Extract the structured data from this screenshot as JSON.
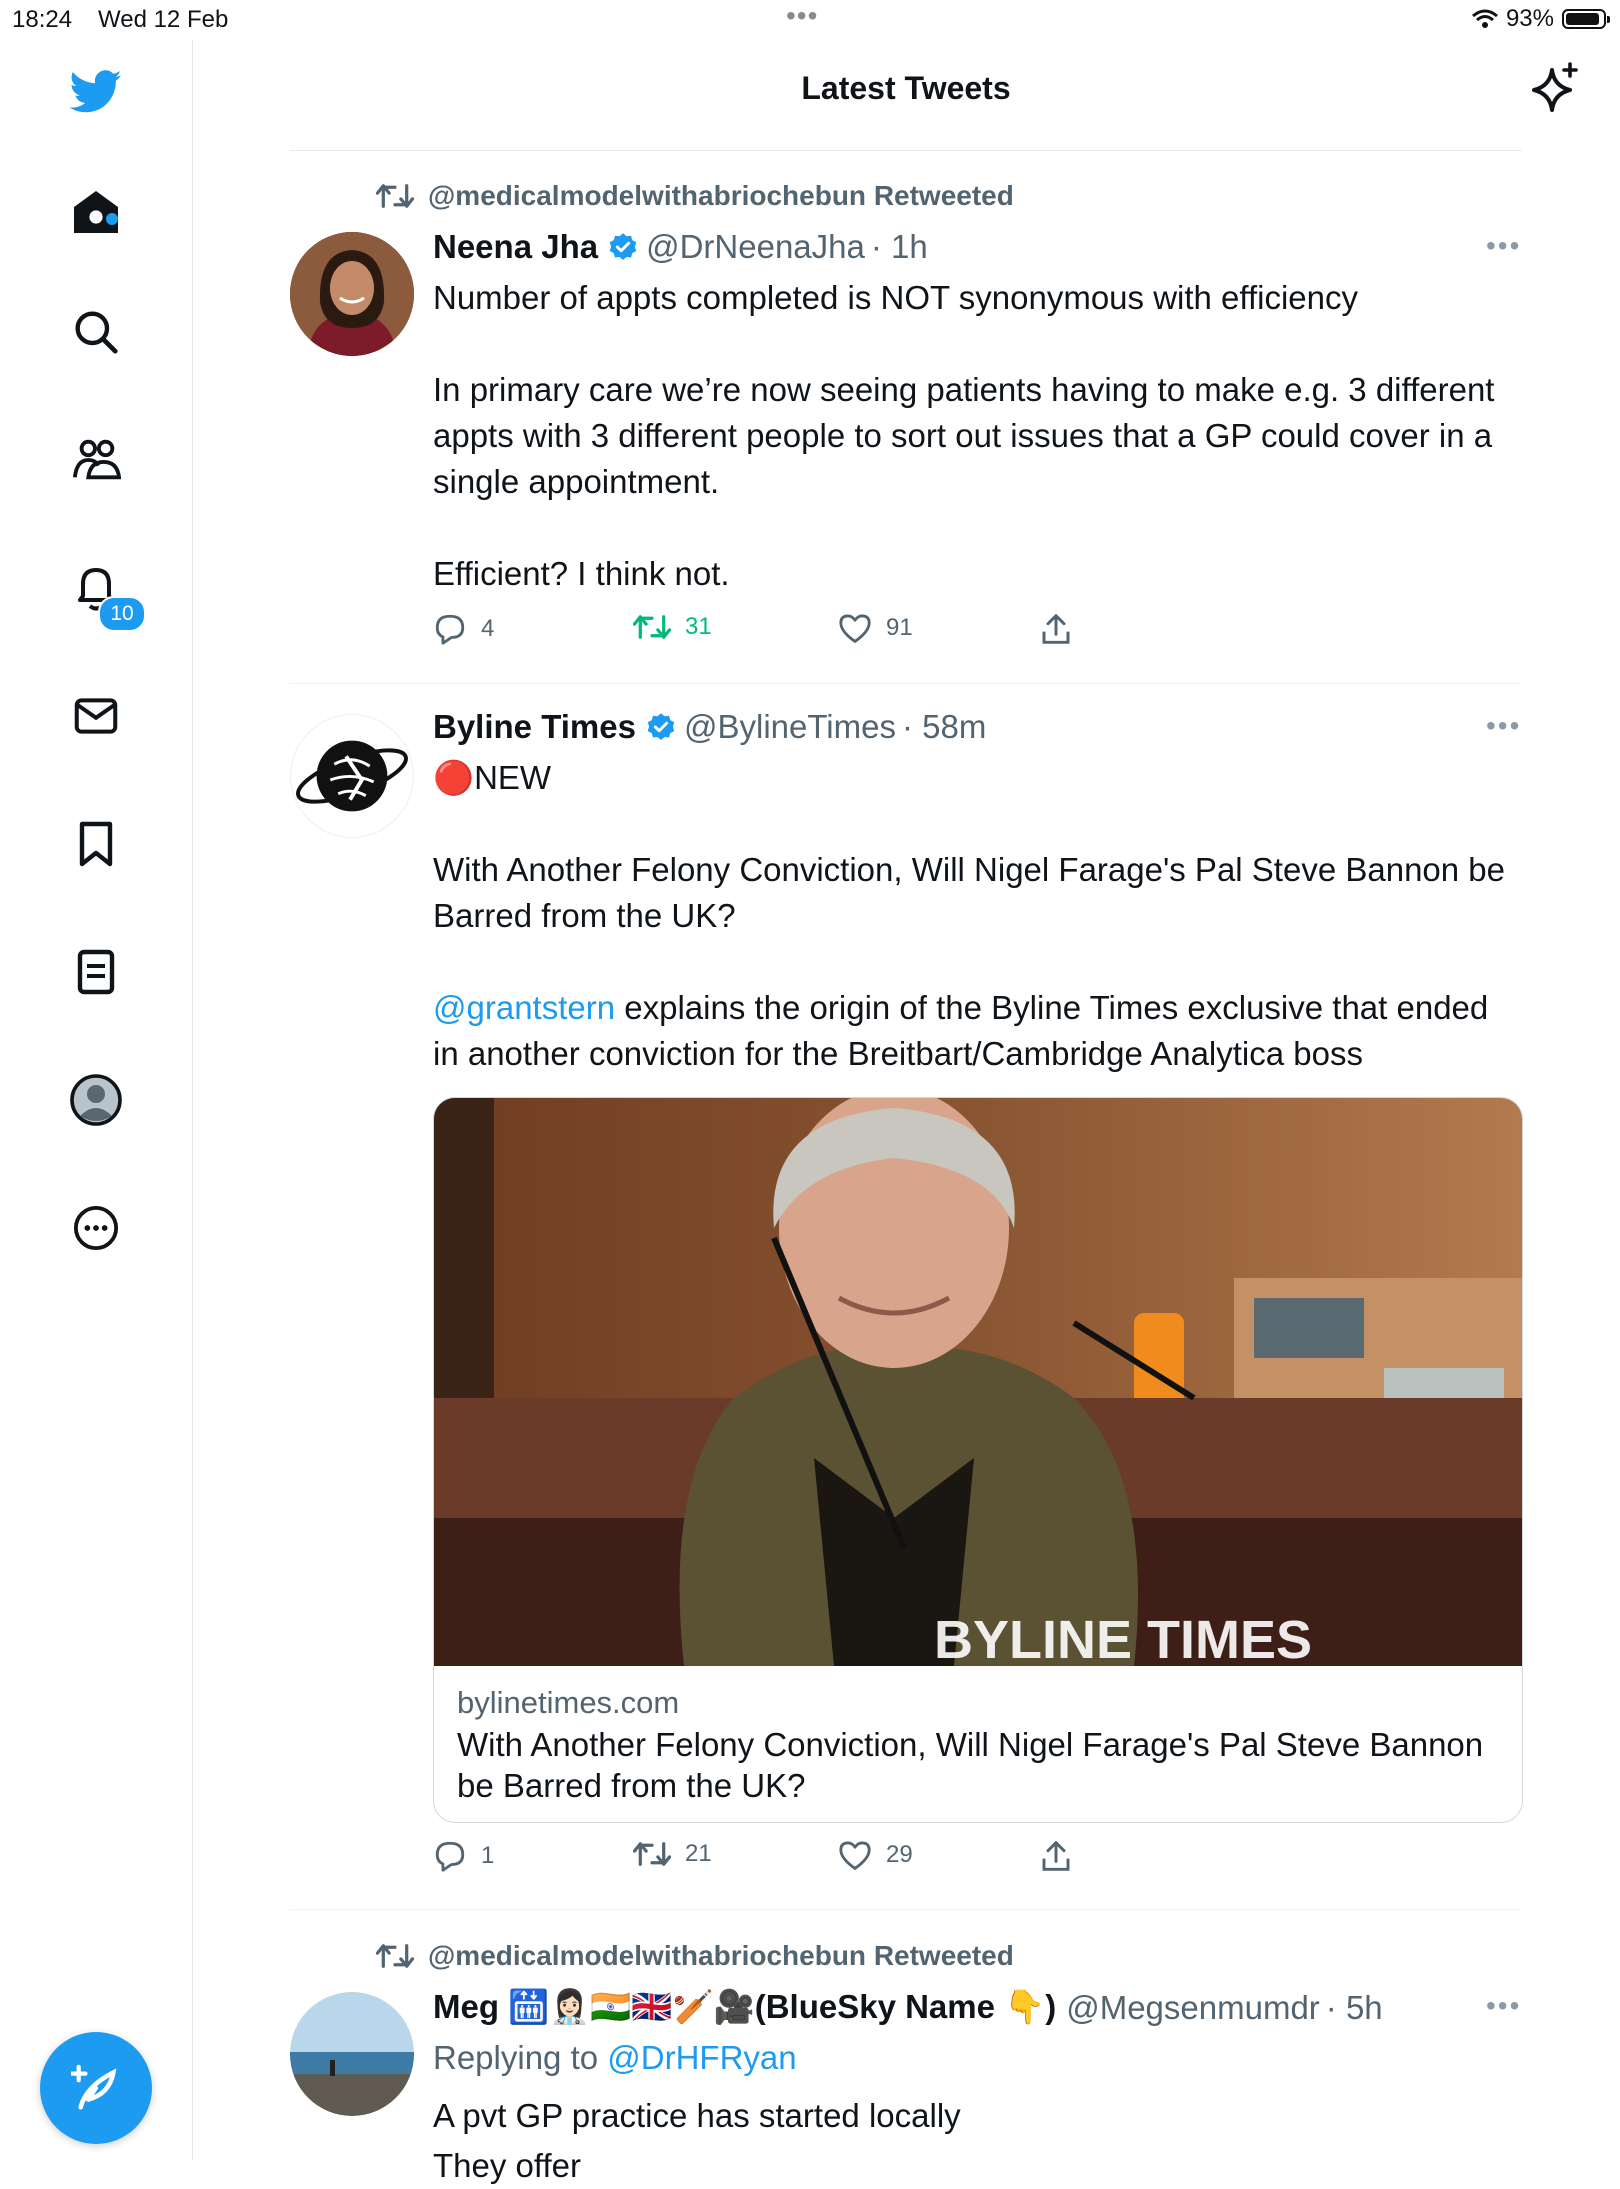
{
  "status_bar": {
    "time": "18:24",
    "date": "Wed 12 Feb",
    "battery": "93%",
    "battery_level": 0.93
  },
  "header": {
    "title": "Latest Tweets"
  },
  "sidebar": {
    "notifications_badge": "10"
  },
  "tweets": [
    {
      "retweeted_by": "@medicalmodelwithabriochebun Retweeted",
      "name": "Neena Jha",
      "handle": "@DrNeenaJha",
      "time": "· 1h",
      "paragraphs": [
        "Number of appts completed is NOT synonymous with efficiency",
        "In primary care we’re now seeing patients having to make e.g. 3 different appts with 3 different people to sort out issues that a GP could cover in a single appointment.",
        "Efficient? I think not."
      ],
      "replies": "4",
      "retweets": "31",
      "likes": "91"
    },
    {
      "name": "Byline Times",
      "handle": "@BylineTimes",
      "time": "· 58m",
      "badge_text": "🔴NEW",
      "paragraph2": "With Another Felony Conviction, Will Nigel Farage's Pal Steve Bannon be Barred from the UK?",
      "mention": "@grantstern",
      "paragraph3_rest": " explains the origin of the Byline Times exclusive that ended in another conviction for the Breitbart/Cambridge Analytica boss",
      "card": {
        "image_watermark": "BYLINE TIMES",
        "domain": "bylinetimes.com",
        "title": "With Another Felony Conviction, Will Nigel Farage's Pal Steve Bannon be Barred from the UK?"
      },
      "replies": "1",
      "retweets": "21",
      "likes": "29"
    },
    {
      "retweeted_by": "@medicalmodelwithabriochebun Retweeted",
      "name": "Meg 🛗👩🏻‍⚕️🇮🇳🇬🇧🏏🎥(BlueSky Name 👇)",
      "handle": "@Megsenmumdr",
      "time": "· 5h",
      "replying_prefix": "Replying to ",
      "replying_to": "@DrHFRyan",
      "text": "A pvt GP practice has started locally",
      "text_cut": "They offer"
    }
  ]
}
